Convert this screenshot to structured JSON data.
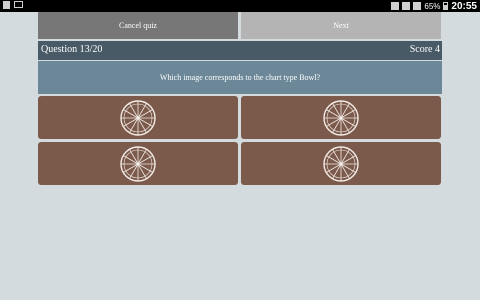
{
  "status_bar": {
    "battery": "65%",
    "time": "20:55"
  },
  "toolbar": {
    "cancel_label": "Cancel quiz",
    "next_label": "Next"
  },
  "header": {
    "question_counter": "Question 13/20",
    "score": "Score 4"
  },
  "question": {
    "text": "Which image corresponds to the chart type Bowl?"
  },
  "answers": [
    {
      "icon": "bowl-chart-icon"
    },
    {
      "icon": "bowl-chart-icon"
    },
    {
      "icon": "bowl-chart-icon"
    },
    {
      "icon": "bowl-chart-icon"
    }
  ],
  "colors": {
    "background": "#d3dbdf",
    "header": "#485a66",
    "question_bg": "#6c8898",
    "answer_bg": "#7b5a4c",
    "cancel_bg": "#777777",
    "next_bg": "#b4b4b4"
  }
}
